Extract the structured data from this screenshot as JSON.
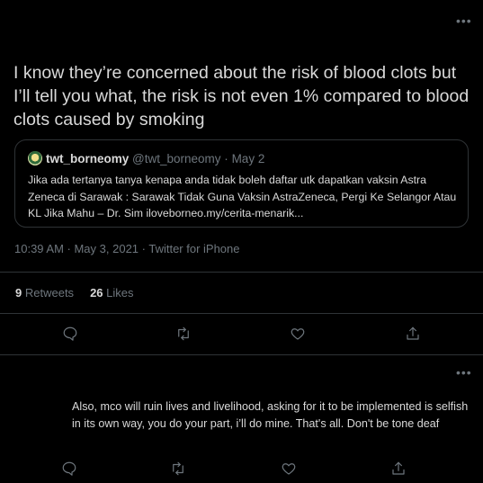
{
  "main_tweet": {
    "text": "I know they’re concerned about the risk of blood clots but I’ll tell you what, the risk is not even 1% compared to blood clots caused by smoking",
    "more_icon": "more-horizontal-icon",
    "quoted": {
      "name": "twt_borneomy",
      "handle": "@twt_borneomy",
      "separator": "·",
      "date": "May 2",
      "text": "Jika ada tertanya tanya kenapa anda tidak boleh daftar utk dapatkan vaksin Astra Zeneca di Sarawak : Sarawak Tidak Guna Vaksin AstraZeneca, Pergi Ke Selangor Atau KL Jika Mahu – Dr. Sim iloveborneo.my/cerita-menarik..."
    },
    "meta": "10:39 AM · May 3, 2021 · Twitter for iPhone",
    "stats": {
      "retweets_count": "9",
      "retweets_label": "Retweets",
      "likes_count": "26",
      "likes_label": "Likes"
    },
    "actions": [
      "reply-icon",
      "retweet-icon",
      "like-icon",
      "share-icon"
    ]
  },
  "reply_tweet": {
    "text": "Also, mco will ruin lives and livelihood, asking for it to be implemented is selfish in its own way, you do your part, i’ll do mine. That's all. Don't be tone deaf",
    "more_icon": "more-horizontal-icon",
    "actions": [
      "reply-icon",
      "retweet-icon",
      "like-icon",
      "share-icon"
    ]
  },
  "colors": {
    "background": "#000000",
    "text": "#d9d9d9",
    "muted": "#6e767d",
    "border": "#2f3336"
  }
}
